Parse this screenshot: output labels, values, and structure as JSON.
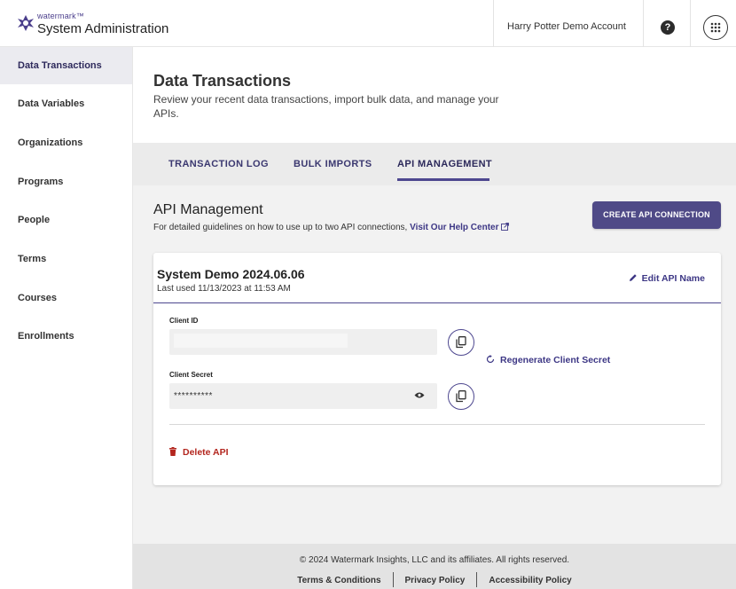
{
  "header": {
    "brand_small": "watermark™",
    "title": "System Administration",
    "account": "Harry Potter Demo Account",
    "help_glyph": "?",
    "icons": {
      "help": "help-circle-icon",
      "apps": "apps-grid-icon",
      "logo": "watermark-logo"
    }
  },
  "sidebar": {
    "items": [
      {
        "label": "Data Transactions"
      },
      {
        "label": "Data Variables"
      },
      {
        "label": "Organizations"
      },
      {
        "label": "Programs"
      },
      {
        "label": "People"
      },
      {
        "label": "Terms"
      },
      {
        "label": "Courses"
      },
      {
        "label": "Enrollments"
      }
    ],
    "active_index": 0
  },
  "page": {
    "title": "Data Transactions",
    "subtitle": "Review your recent data transactions, import bulk data, and manage your APIs."
  },
  "tabs": [
    {
      "label": "TRANSACTION LOG"
    },
    {
      "label": "BULK IMPORTS"
    },
    {
      "label": "API MANAGEMENT"
    }
  ],
  "active_tab": 2,
  "api": {
    "section_title": "API Management",
    "description": "For detailed guidelines on how to use up to two API connections, ",
    "help_link": "Visit Our Help Center",
    "create_button": "CREATE API CONNECTION",
    "card": {
      "name": "System Demo 2024.06.06",
      "last_used": "Last used 11/13/2023 at 11:53 AM",
      "edit_label": "Edit API Name",
      "client_id_label": "Client ID",
      "client_id_value": "",
      "client_secret_label": "Client Secret",
      "client_secret_value": "**********",
      "regenerate_label": "Regenerate Client Secret",
      "delete_label": "Delete API"
    }
  },
  "footer": {
    "copyright": "© 2024 Watermark Insights, LLC and its affiliates. All rights reserved.",
    "links": [
      "Terms & Conditions",
      "Privacy Policy",
      "Accessibility Policy"
    ]
  },
  "colors": {
    "accent": "#4f4a87",
    "link": "#3d3785",
    "danger": "#b3261e",
    "sidebar_active": "#ebebf0",
    "main_bg": "#f2f2f2"
  }
}
